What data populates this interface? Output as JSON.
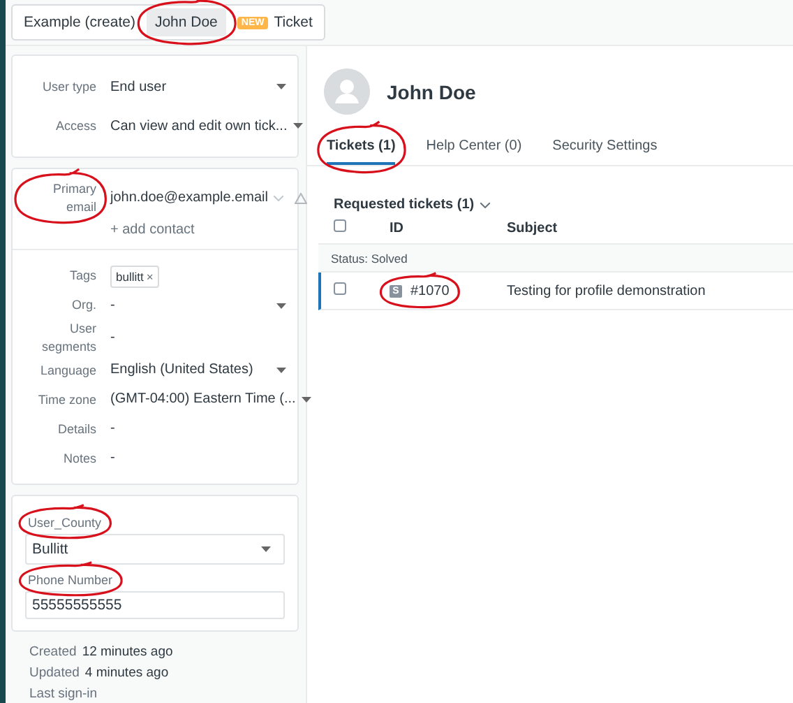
{
  "header_tabs": [
    {
      "label": "Example (create)",
      "selected": false,
      "annotated": false
    },
    {
      "label": "John Doe",
      "selected": true,
      "annotated": true
    },
    {
      "badge": "NEW",
      "label": "Ticket",
      "selected": false,
      "annotated": false
    }
  ],
  "user_fields": [
    {
      "label": "User type",
      "value": "End user",
      "kind": "dropdown"
    },
    {
      "label": "Access",
      "value": "Can view and edit own tick...",
      "kind": "dropdown"
    }
  ],
  "contact": {
    "label": "Primary email",
    "value": "john.doe@example.email",
    "annotated": true,
    "add_link": "+ add contact"
  },
  "details": [
    {
      "label": "Tags",
      "kind": "tags",
      "tags": [
        {
          "text": "bullitt",
          "remove": "×"
        }
      ]
    },
    {
      "label": "Org.",
      "value": "-",
      "kind": "dropdown"
    },
    {
      "label": "User segments",
      "value": "-",
      "kind": "text"
    },
    {
      "label": "Language",
      "value": "English (United States)",
      "kind": "dropdown"
    },
    {
      "label": "Time zone",
      "value": "(GMT-04:00) Eastern Time (...",
      "kind": "dropdown"
    },
    {
      "label": "Details",
      "value": "-",
      "kind": "text"
    },
    {
      "label": "Notes",
      "value": "-",
      "kind": "text"
    }
  ],
  "custom_fields": [
    {
      "label": "User_County",
      "value": "Bullitt",
      "kind": "dropdown",
      "annotated": true
    },
    {
      "label": "Phone Number",
      "value": "55555555555",
      "kind": "input",
      "annotated": true
    }
  ],
  "meta": [
    {
      "label": "Created",
      "value": "12 minutes ago"
    },
    {
      "label": "Updated",
      "value": "4 minutes ago"
    },
    {
      "label": "Last sign-in"
    }
  ],
  "profile": {
    "name": "John Doe"
  },
  "profile_tabs": [
    {
      "label": "Tickets (1)",
      "selected": true,
      "annotated": true
    },
    {
      "label": "Help Center (0)",
      "selected": false,
      "annotated": false
    },
    {
      "label": "Security Settings",
      "selected": false,
      "annotated": false
    }
  ],
  "tickets": {
    "view_title": "Requested tickets (1)",
    "select_all_checked": false,
    "columns": [
      "ID",
      "Subject"
    ],
    "group": "Status: Solved",
    "rows": [
      {
        "status_letter": "S",
        "id": "#1070",
        "subject": "Testing for profile demonstration",
        "checked": false,
        "annotated": true
      }
    ]
  }
}
